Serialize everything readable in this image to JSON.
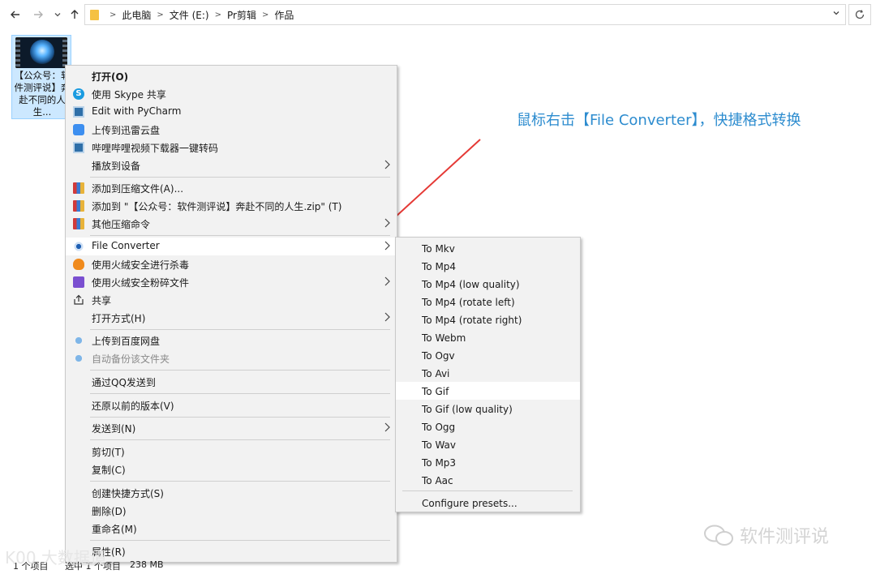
{
  "address_bar": {
    "breadcrumbs": [
      "此电脑",
      "文件 (E:)",
      "Pr剪辑",
      "作品"
    ],
    "back_icon": "arrow-left",
    "forward_icon": "arrow-right",
    "recent_icon": "chevron-down",
    "up_icon": "arrow-up",
    "refresh_icon": "refresh"
  },
  "file": {
    "name": "【公众号：软件测评说】奔赴不同的人生..."
  },
  "annotation": {
    "text": "鼠标右击【File Converter】，快捷格式转换",
    "color": "#2d8ccf"
  },
  "context_menu": {
    "items": [
      {
        "label": "打开(O)",
        "icon": "none"
      },
      {
        "label": "使用 Skype 共享",
        "icon": "skype-icon"
      },
      {
        "label": "Edit with PyCharm",
        "icon": "pycharm-icon"
      },
      {
        "label": "上传到迅雷云盘",
        "icon": "thunder-icon"
      },
      {
        "label": "哔哩哔哩视频下载器一键转码",
        "icon": "bilibili-icon"
      },
      {
        "label": "播放到设备",
        "icon": "none"
      },
      {
        "label": "添加到压缩文件(A)...",
        "icon": "winrar-icon"
      },
      {
        "label": "添加到 \"【公众号：软件测评说】奔赴不同的人生.zip\" (T)",
        "icon": "winrar-icon"
      },
      {
        "label": "其他压缩命令",
        "icon": "winrar-icon"
      },
      {
        "label": "File Converter",
        "icon": "file-converter-icon"
      },
      {
        "label": "使用火绒安全进行杀毒",
        "icon": "huorong-icon"
      },
      {
        "label": "使用火绒安全粉碎文件",
        "icon": "shredder-icon"
      },
      {
        "label": "共享",
        "icon": "share-icon"
      },
      {
        "label": "打开方式(H)",
        "icon": "none"
      },
      {
        "label": "上传到百度网盘",
        "icon": "baidu-cloud-icon"
      },
      {
        "label": "自动备份该文件夹",
        "icon": "baidu-cloud-icon"
      },
      {
        "label": "通过QQ发送到",
        "icon": "none"
      },
      {
        "label": "还原以前的版本(V)",
        "icon": "none"
      },
      {
        "label": "发送到(N)",
        "icon": "none"
      },
      {
        "label": "剪切(T)",
        "icon": "none"
      },
      {
        "label": "复制(C)",
        "icon": "none"
      },
      {
        "label": "创建快捷方式(S)",
        "icon": "none"
      },
      {
        "label": "删除(D)",
        "icon": "none"
      },
      {
        "label": "重命名(M)",
        "icon": "none"
      },
      {
        "label": "属性(R)",
        "icon": "none"
      }
    ]
  },
  "submenu": {
    "items": [
      "To Mkv",
      "To Mp4",
      "To Mp4 (low quality)",
      "To Mp4 (rotate left)",
      "To Mp4 (rotate right)",
      "To Webm",
      "To Ogv",
      "To Avi",
      "To Gif",
      "To Gif (low quality)",
      "To Ogg",
      "To Wav",
      "To Mp3",
      "To Aac",
      "Configure presets..."
    ]
  },
  "status_bar": {
    "count": "1 个项目",
    "selected": "选中 1 个项目",
    "size": "238 MB"
  },
  "watermarks": {
    "right": "软件测评说",
    "left": "K00 大数据谭"
  }
}
